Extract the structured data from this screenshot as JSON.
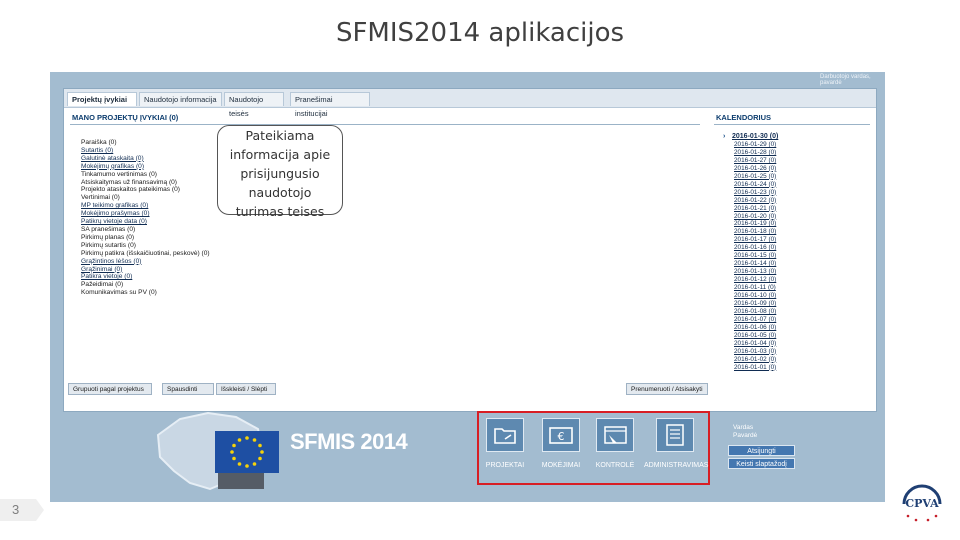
{
  "slide": {
    "title": "SFMIS2014 aplikacijos",
    "page_number": "3"
  },
  "frame": {
    "topline": "Darbuotojo vardas, pavardė"
  },
  "tabs": [
    {
      "label": "Projektų įvykiai",
      "active": true
    },
    {
      "label": "Naudotojo informacija",
      "active": false
    },
    {
      "label": "Naudotojo teisės",
      "active": false
    },
    {
      "label": "Pranešimai institucijai",
      "active": false
    }
  ],
  "events_panel": {
    "header": "MANO PROJEKTŲ ĮVYKIAI (0)",
    "items": [
      {
        "label": "Paraiška (0)",
        "link": false
      },
      {
        "label": "Sutartis (0)",
        "link": true
      },
      {
        "label": "Galutinė ataskaita (0)",
        "link": true
      },
      {
        "label": "Mokėjimų grafikas (0)",
        "link": true
      },
      {
        "label": "Tinkamumo vertinimas (0)",
        "link": false
      },
      {
        "label": "Atsiskaitymas už finansavimą (0)",
        "link": false
      },
      {
        "label": "Projekto ataskaitos pateikimas (0)",
        "link": false
      },
      {
        "label": "Vertinimai (0)",
        "link": false
      },
      {
        "label": "MP teikimo grafikas (0)",
        "link": true
      },
      {
        "label": "Mokėjimo prašymas (0)",
        "link": true
      },
      {
        "label": "Patikrų vietoje data (0)",
        "link": true
      },
      {
        "label": "SA pranešimas (0)",
        "link": false
      },
      {
        "label": "Pirkimų planas (0)",
        "link": false
      },
      {
        "label": "Pirkimų sutartis (0)",
        "link": false
      },
      {
        "label": "Pirkimų patikra (išskaičiuotinai, peskovė) (0)",
        "link": false
      },
      {
        "label": "Grąžintinos lėšos (0)",
        "link": true
      },
      {
        "label": "Grąžinimai (0)",
        "link": true
      },
      {
        "label": "Patikra vietoje (0)",
        "link": true
      },
      {
        "label": "Pažeidimai (0)",
        "link": false
      },
      {
        "label": "Komunikavimas su PV (0)",
        "link": false
      }
    ]
  },
  "calendar": {
    "header": "KALENDORIUS",
    "dates": [
      "2016-01-30 (0)",
      "2016-01-29 (0)",
      "2016-01-28 (0)",
      "2016-01-27 (0)",
      "2016-01-26 (0)",
      "2016-01-25 (0)",
      "2016-01-24 (0)",
      "2016-01-23 (0)",
      "2016-01-22 (0)",
      "2016-01-21 (0)",
      "2016-01-20 (0)",
      "2016-01-19 (0)",
      "2016-01-18 (0)",
      "2016-01-17 (0)",
      "2016-01-16 (0)",
      "2016-01-15 (0)",
      "2016-01-14 (0)",
      "2016-01-13 (0)",
      "2016-01-12 (0)",
      "2016-01-11 (0)",
      "2016-01-10 (0)",
      "2016-01-09 (0)",
      "2016-01-08 (0)",
      "2016-01-07 (0)",
      "2016-01-06 (0)",
      "2016-01-05 (0)",
      "2016-01-04 (0)",
      "2016-01-03 (0)",
      "2016-01-02 (0)",
      "2016-01-01 (0)"
    ]
  },
  "bottom_buttons": {
    "group": "Grupuoti pagal projektus",
    "print": "Spausdinti",
    "expand": "Išskleisti / Slėpti",
    "subscribe": "Prenumeruoti / Atsisakyti"
  },
  "callout": {
    "lines": [
      "Pateikiama",
      "informacija apie",
      "prisijungusio",
      "naudotojo",
      "turimas teises"
    ]
  },
  "brand": {
    "name": "SFMIS 2014"
  },
  "modules": [
    {
      "label": "PROJEKTAI",
      "icon": "folder-icon"
    },
    {
      "label": "MOKĖJIMAI",
      "icon": "euro-icon"
    },
    {
      "label": "KONTROLĖ",
      "icon": "cursor-window-icon"
    },
    {
      "label": "ADMINISTRAVIMAS",
      "icon": "list-document-icon"
    }
  ],
  "user": {
    "label_lines": [
      "Vardas",
      "Pavardė"
    ],
    "logout": "Atsijungti",
    "change_password": "Keisti slaptažodį"
  },
  "colors": {
    "frame": "#a3bcd0",
    "highlight": "#d81e24",
    "module": "#5e89b0",
    "flag": "#1e4fa3"
  }
}
